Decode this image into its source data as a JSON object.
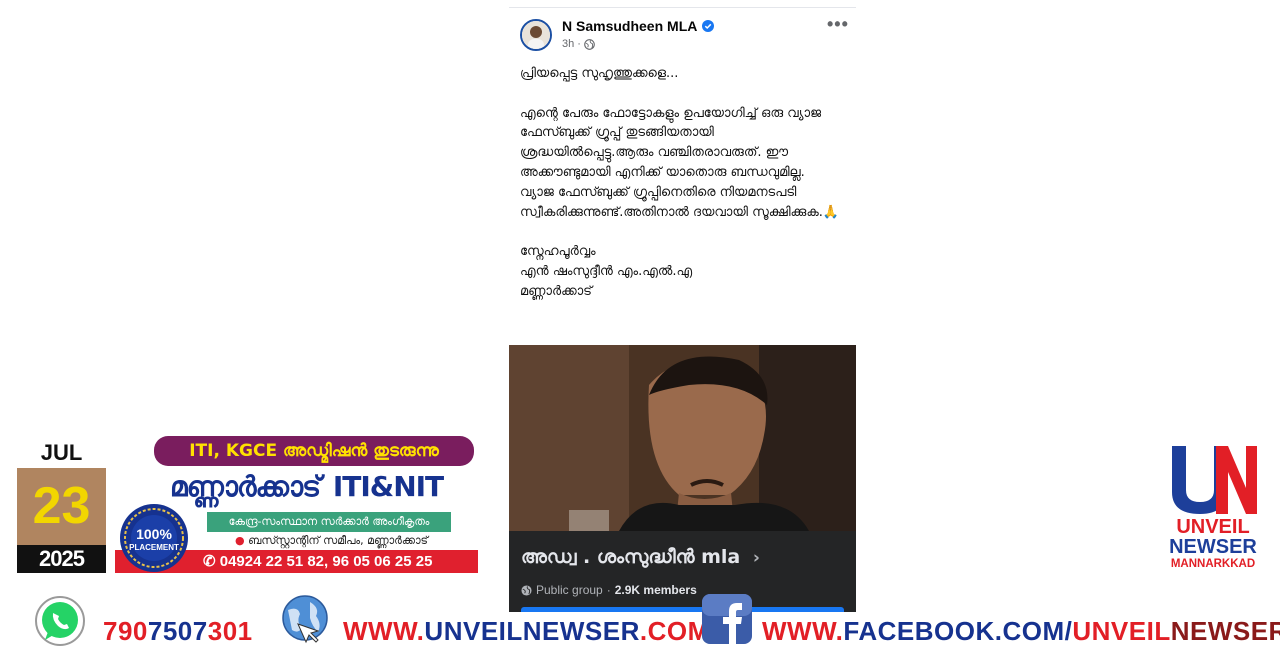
{
  "post": {
    "author": "N Samsudheen MLA",
    "time": "3h",
    "more_label": "•••",
    "body": "പ്രിയപ്പെട്ട സുഹൃത്തുക്കളെ...\n\nഎന്റെ പേരും ഫോട്ടോകളും ഉപയോഗിച്ച് ഒരു വ്യാജ ഫേസ്ബുക്ക് ഗ്രൂപ്പ്  തുടങ്ങിയതായി ശ്രദ്ധയിൽപ്പെട്ടു.ആരും വഞ്ചിതരാവരുത്. ഈ അക്കൗണ്ടുമായി  എനിക്ക് യാതൊരു ബന്ധവുമില്ല.  വ്യാജ ഫേസ്ബുക്ക് ഗ്രൂപ്പിനെതിരെ   നിയമനടപടി സ്വീകരിക്കുന്നുണ്ട്.അതിനാൽ ദയവായി സൂക്ഷിക്കുക.🙏\n\n സ്നേഹപൂർവ്വം\nഎൻ ഷംസുദ്ദീൻ എം.എൽ.എ\nമണ്ണാർക്കാട്",
    "group": {
      "name": "അഡ്വ . ശംസുദ്ധീൻ mla",
      "privacy": "Public group",
      "members": "2.9K members",
      "separator": "·",
      "chevron": "›"
    }
  },
  "date": {
    "month": "JUL",
    "day": "23",
    "year": "2025"
  },
  "ad": {
    "banner": "ITI, KGCE അഡ്മിഷൻ തുടരുന്നു",
    "title_ml": "മണ്ണാർക്കാട്",
    "title_en": "ITI&NIT",
    "approval": "കേന്ദ്ര-സംസ്ഥാന സർക്കാർ അംഗീകൃതം",
    "address": "ബസ്സ്റ്റാന്റിന് സമീപം, മണ്ണാർക്കാട്",
    "phone": "04924 22 51 82, 96 05 06 25 25",
    "seal_pct": "100%",
    "seal_label": "PLACEMENT"
  },
  "logo": {
    "letters": "UN",
    "line1": "UNVEIL",
    "line2": "NEWSER",
    "line3": "MANNARKKAD"
  },
  "footer": {
    "phone_a": "790",
    "phone_b": "7507",
    "phone_c": "301",
    "web_a": "WWW.",
    "web_b": "UNVEILNEWSER",
    "web_c": ".COM",
    "fb_a": "WWW.",
    "fb_b": "FACEBOOK.COM/",
    "fb_c": "UNVEIL",
    "fb_d": "NEWSER"
  },
  "colors": {
    "brand_red": "#e21f26",
    "brand_blue": "#16328f",
    "fb_blue": "#1877f2",
    "date_gold": "#f2d600"
  }
}
